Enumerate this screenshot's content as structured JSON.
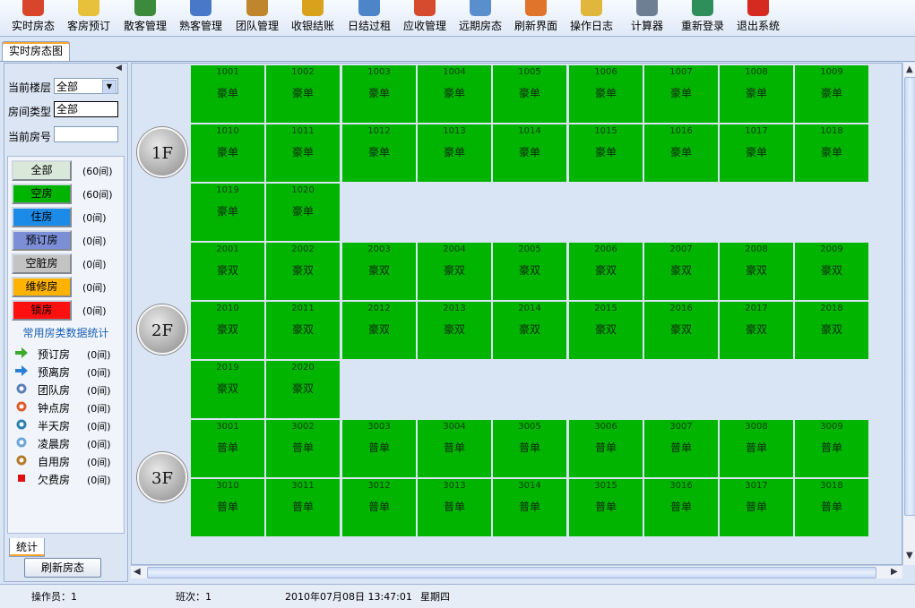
{
  "toolbar": [
    {
      "label": "实时房态",
      "icon": "house-icon",
      "color": "#d9452b"
    },
    {
      "label": "客房预订",
      "icon": "notepad-icon",
      "color": "#e8c13a"
    },
    {
      "label": "散客管理",
      "icon": "single-guest-icon",
      "color": "#3c8a3c"
    },
    {
      "label": "熟客管理",
      "icon": "windows-icon",
      "color": "#4a78c8"
    },
    {
      "label": "团队管理",
      "icon": "group-icon",
      "color": "#c0862e"
    },
    {
      "label": "收银结账",
      "icon": "cash-register-icon",
      "color": "#d8a21c"
    },
    {
      "label": "日结过租",
      "icon": "clock-icon",
      "color": "#4c86c9"
    },
    {
      "label": "应收管理",
      "icon": "pie-chart-icon",
      "color": "#d64b2e"
    },
    {
      "label": "远期房态",
      "icon": "search-doc-icon",
      "color": "#5a8fce"
    },
    {
      "label": "刷新界面",
      "icon": "refresh-icon",
      "color": "#e0742a"
    },
    {
      "label": "操作日志",
      "icon": "folder-icon",
      "color": "#e0b63d"
    },
    {
      "label": "计算器",
      "icon": "calculator-icon",
      "color": "#6f7f93"
    },
    {
      "label": "重新登录",
      "icon": "relogin-icon",
      "color": "#2e8f5a"
    },
    {
      "label": "退出系统",
      "icon": "power-icon",
      "color": "#d52a1f"
    }
  ],
  "tab": {
    "label": "实时房态图"
  },
  "filters": {
    "floor_label": "当前楼层",
    "floor_value": "全部",
    "type_label": "房间类型",
    "type_value": "全部",
    "room_label": "当前房号",
    "room_value": ""
  },
  "status_buttons": [
    {
      "label": "全部",
      "count": "(60间)",
      "color": "#d9e8d9"
    },
    {
      "label": "空房",
      "count": "(60间)",
      "color": "#00b400"
    },
    {
      "label": "住房",
      "count": "(0间)",
      "color": "#1c8be8"
    },
    {
      "label": "预订房",
      "count": "(0间)",
      "color": "#7b8ed6"
    },
    {
      "label": "空脏房",
      "count": "(0间)",
      "color": "#c3c3c3"
    },
    {
      "label": "维修房",
      "count": "(0间)",
      "color": "#ffb300"
    },
    {
      "label": "锁房",
      "count": "(0间)",
      "color": "#ff1010"
    }
  ],
  "stats": {
    "title": "常用房类数据统计",
    "items": [
      {
        "label": "预订房",
        "count": "(0间)",
        "icon": "right-arrow-green-icon",
        "color": "#3daa2e"
      },
      {
        "label": "预离房",
        "count": "(0间)",
        "icon": "right-arrow-blue-icon",
        "color": "#2a7fd6"
      },
      {
        "label": "团队房",
        "count": "(0间)",
        "icon": "team-people-icon",
        "color": "#5d7fb8"
      },
      {
        "label": "钟点房",
        "count": "(0间)",
        "icon": "alarm-clock-icon",
        "color": "#e05a2a"
      },
      {
        "label": "半天房",
        "count": "(0间)",
        "icon": "half-day-icon",
        "color": "#2b7fb0"
      },
      {
        "label": "凌晨房",
        "count": "(0间)",
        "icon": "light-bulb-icon",
        "color": "#6aa6d8"
      },
      {
        "label": "自用房",
        "count": "(0间)",
        "icon": "coffee-cup-icon",
        "color": "#b47a2a"
      },
      {
        "label": "欠费房",
        "count": "(0间)",
        "icon": "red-square-icon",
        "color": "#e01010"
      }
    ]
  },
  "stats_tab": {
    "label": "统计"
  },
  "refresh_button": {
    "label": "刷新房态"
  },
  "floors": [
    {
      "label": "1F",
      "rooms": [
        {
          "num": "1001",
          "type": "豪单"
        },
        {
          "num": "1002",
          "type": "豪单"
        },
        {
          "num": "1003",
          "type": "豪单"
        },
        {
          "num": "1004",
          "type": "豪单"
        },
        {
          "num": "1005",
          "type": "豪单"
        },
        {
          "num": "1006",
          "type": "豪单"
        },
        {
          "num": "1007",
          "type": "豪单"
        },
        {
          "num": "1008",
          "type": "豪单"
        },
        {
          "num": "1009",
          "type": "豪单"
        },
        {
          "num": "1010",
          "type": "豪单"
        },
        {
          "num": "1011",
          "type": "豪单"
        },
        {
          "num": "1012",
          "type": "豪单"
        },
        {
          "num": "1013",
          "type": "豪单"
        },
        {
          "num": "1014",
          "type": "豪单"
        },
        {
          "num": "1015",
          "type": "豪单"
        },
        {
          "num": "1016",
          "type": "豪单"
        },
        {
          "num": "1017",
          "type": "豪单"
        },
        {
          "num": "1018",
          "type": "豪单"
        },
        {
          "num": "1019",
          "type": "豪单"
        },
        {
          "num": "1020",
          "type": "豪单"
        }
      ]
    },
    {
      "label": "2F",
      "rooms": [
        {
          "num": "2001",
          "type": "豪双"
        },
        {
          "num": "2002",
          "type": "豪双"
        },
        {
          "num": "2003",
          "type": "豪双"
        },
        {
          "num": "2004",
          "type": "豪双"
        },
        {
          "num": "2005",
          "type": "豪双"
        },
        {
          "num": "2006",
          "type": "豪双"
        },
        {
          "num": "2007",
          "type": "豪双"
        },
        {
          "num": "2008",
          "type": "豪双"
        },
        {
          "num": "2009",
          "type": "豪双"
        },
        {
          "num": "2010",
          "type": "豪双"
        },
        {
          "num": "2011",
          "type": "豪双"
        },
        {
          "num": "2012",
          "type": "豪双"
        },
        {
          "num": "2013",
          "type": "豪双"
        },
        {
          "num": "2014",
          "type": "豪双"
        },
        {
          "num": "2015",
          "type": "豪双"
        },
        {
          "num": "2016",
          "type": "豪双"
        },
        {
          "num": "2017",
          "type": "豪双"
        },
        {
          "num": "2018",
          "type": "豪双"
        },
        {
          "num": "2019",
          "type": "豪双"
        },
        {
          "num": "2020",
          "type": "豪双"
        }
      ]
    },
    {
      "label": "3F",
      "rooms": [
        {
          "num": "3001",
          "type": "普单"
        },
        {
          "num": "3002",
          "type": "普单"
        },
        {
          "num": "3003",
          "type": "普单"
        },
        {
          "num": "3004",
          "type": "普单"
        },
        {
          "num": "3005",
          "type": "普单"
        },
        {
          "num": "3006",
          "type": "普单"
        },
        {
          "num": "3007",
          "type": "普单"
        },
        {
          "num": "3008",
          "type": "普单"
        },
        {
          "num": "3009",
          "type": "普单"
        },
        {
          "num": "3010",
          "type": "普单"
        },
        {
          "num": "3011",
          "type": "普单"
        },
        {
          "num": "3012",
          "type": "普单"
        },
        {
          "num": "3013",
          "type": "普单"
        },
        {
          "num": "3014",
          "type": "普单"
        },
        {
          "num": "3015",
          "type": "普单"
        },
        {
          "num": "3016",
          "type": "普单"
        },
        {
          "num": "3017",
          "type": "普单"
        },
        {
          "num": "3018",
          "type": "普单"
        }
      ]
    }
  ],
  "room_color": "#00b400",
  "statusbar": {
    "operator": "操作员：1",
    "shift": "班次：1",
    "datetime": "2010年07月08日 13:47:01",
    "weekday": "星期四"
  }
}
